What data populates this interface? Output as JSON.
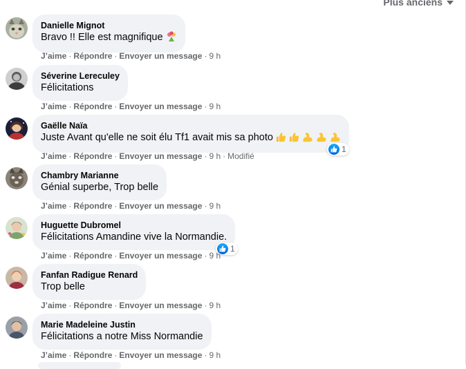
{
  "header": {
    "sort_label": "Plus anciens"
  },
  "actions": {
    "like": "J’aime",
    "reply": "Répondre",
    "message": "Envoyer un message",
    "separator": "·"
  },
  "colors": {
    "bubble": "#f0f2f5",
    "secondary_text": "#65676b",
    "like_blue": "#1877f2"
  },
  "comments": [
    {
      "author": "Danielle Mignot",
      "text": "Bravo !! Elle est magnifique",
      "emoji": "bouquet-icon",
      "time": "9 h"
    },
    {
      "author": "Séverine Lereculey",
      "text": "Félicitations",
      "time": "9 h"
    },
    {
      "author": "Gaëlle Naïa",
      "text": "Juste Avant qu'elle ne soit élu Tf1 avait mis sa photo",
      "emoji": "thumbs-up-and-flexed-biceps-icons",
      "time": "9 h",
      "edited": "Modifié",
      "reactions": "1"
    },
    {
      "author": "Chambry Marianne",
      "text": "Génial superbe, Trop belle",
      "time": "9 h"
    },
    {
      "author": "Huguette Dubromel",
      "text": "Félicitations Amandine vive la Normandie.",
      "time": "9 h",
      "reactions": "1"
    },
    {
      "author": "Fanfan Radigue Renard",
      "text": "Trop belle",
      "time": "9 h"
    },
    {
      "author": "Marie Madeleine Justin",
      "text": "Félicitations a notre Miss Normandie",
      "time": "9 h"
    }
  ]
}
